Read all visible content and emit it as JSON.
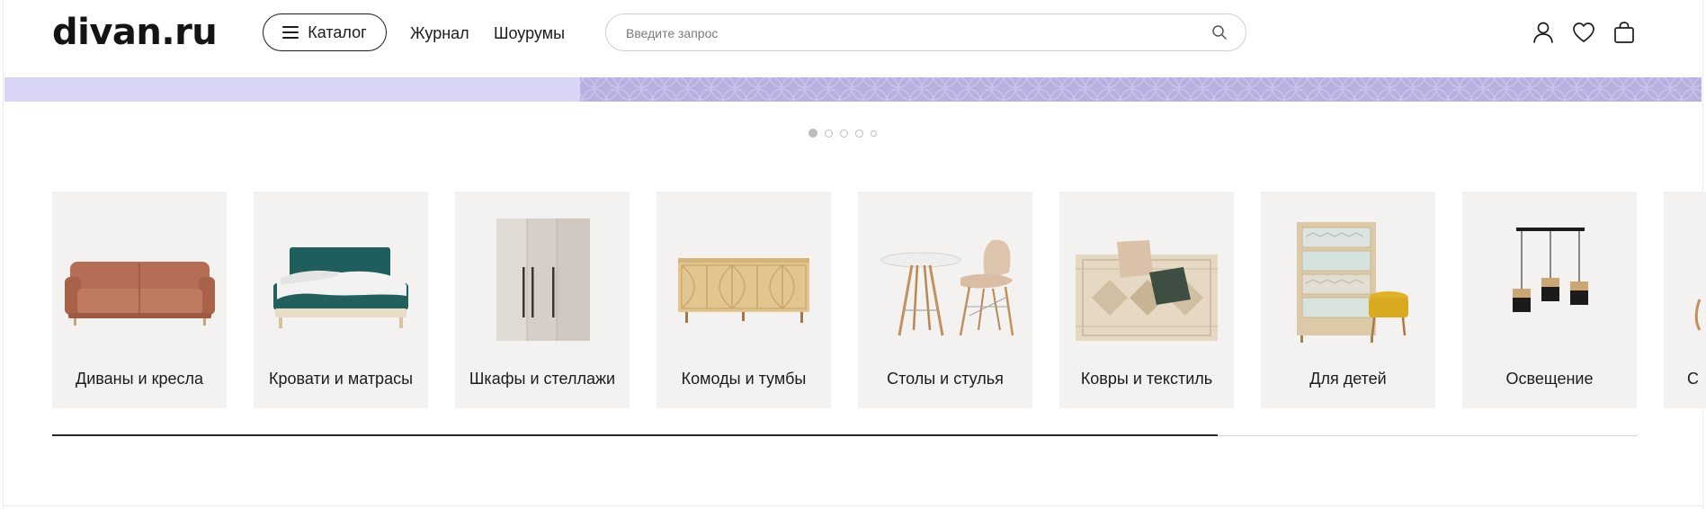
{
  "header": {
    "logo": "divan.ru",
    "catalog_label": "Каталог",
    "nav": [
      {
        "label": "Журнал"
      },
      {
        "label": "Шоурумы"
      }
    ],
    "search": {
      "placeholder": "Введите запрос",
      "value": ""
    },
    "icons": [
      "user-icon",
      "heart-icon",
      "cart-icon"
    ]
  },
  "banner": {
    "background_color": "#d9d5f6",
    "pattern_color": "#b9b0e1"
  },
  "carousel": {
    "total": 5,
    "active_index": 0
  },
  "categories": [
    {
      "label": "Диваны и кресла",
      "icon": "sofa-icon"
    },
    {
      "label": "Кровати и матрасы",
      "icon": "bed-icon"
    },
    {
      "label": "Шкафы и стеллажи",
      "icon": "wardrobe-icon"
    },
    {
      "label": "Комоды и тумбы",
      "icon": "dresser-icon"
    },
    {
      "label": "Столы и стулья",
      "icon": "table-chair-icon"
    },
    {
      "label": "Ковры и текстиль",
      "icon": "rug-icon"
    },
    {
      "label": "Для детей",
      "icon": "kids-icon"
    },
    {
      "label": "Освещение",
      "icon": "lamp-icon"
    },
    {
      "label": "С",
      "icon": "partial-icon"
    }
  ],
  "scroll_progress": 0.735,
  "colors": {
    "card_bg": "#f4f2f0",
    "text": "#1c1c1c"
  }
}
